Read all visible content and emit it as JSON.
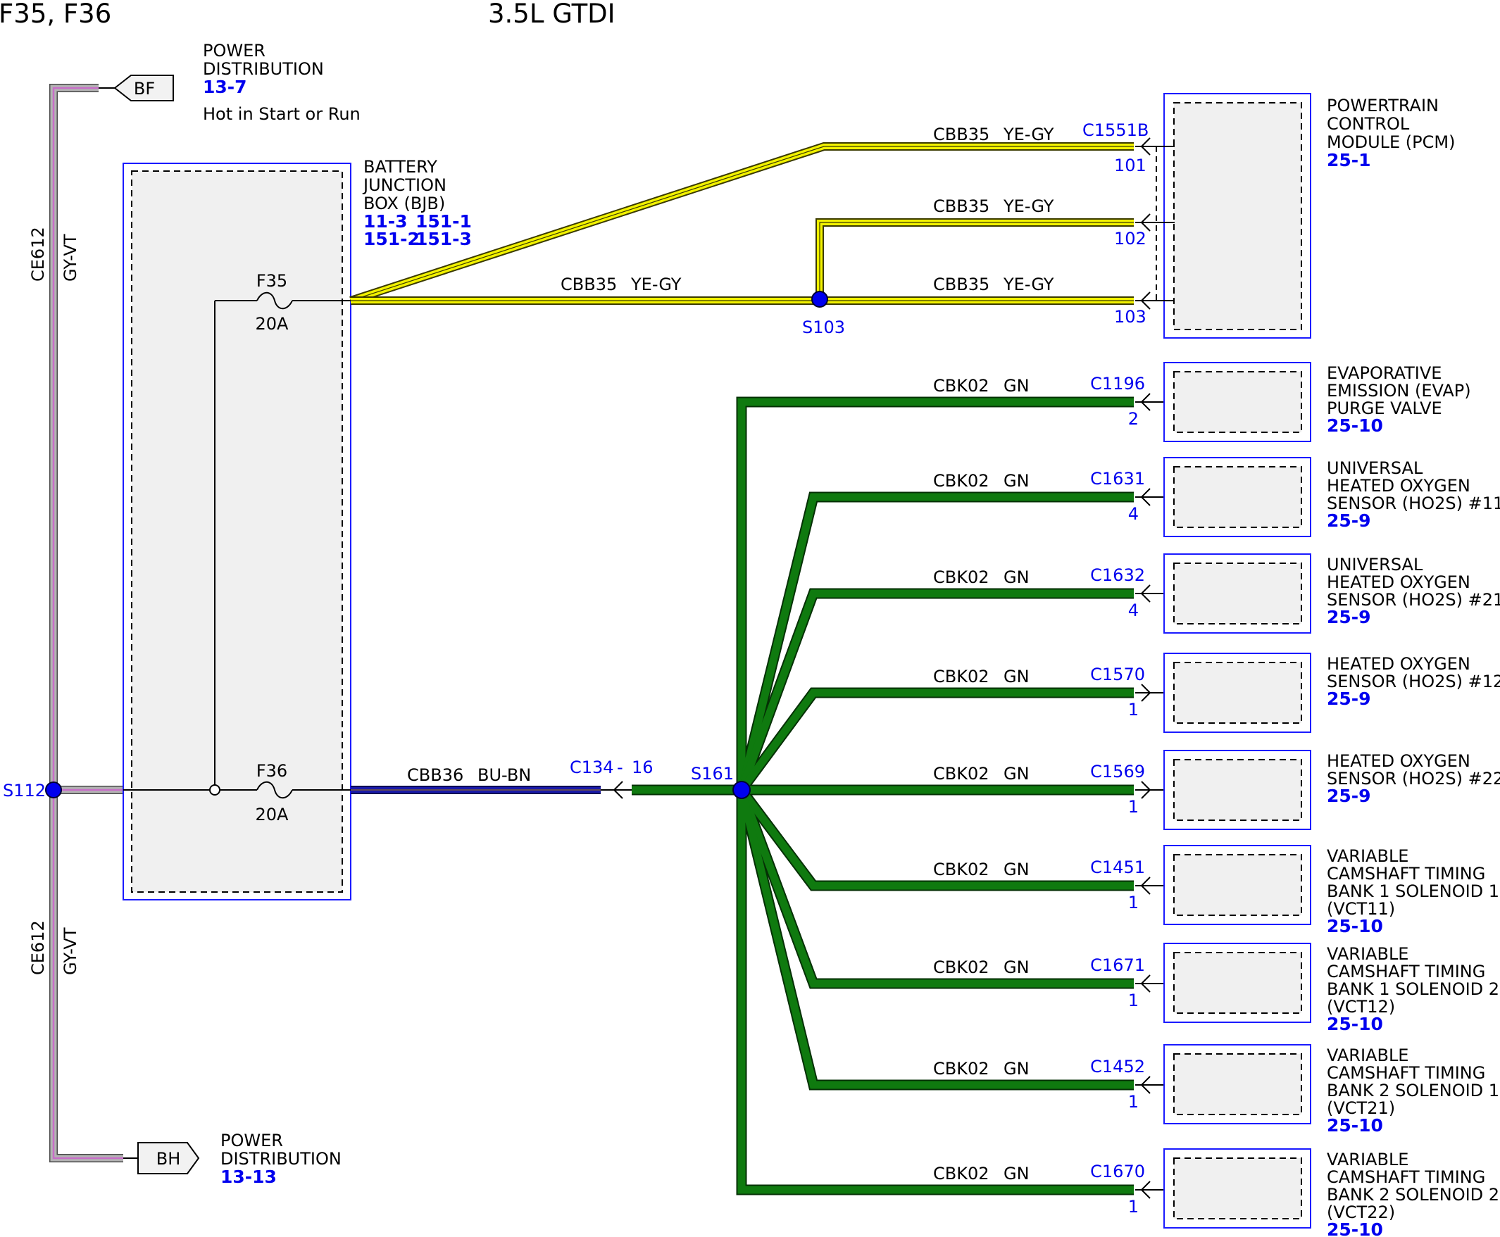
{
  "page": {
    "title_left": "F35, F36",
    "title_center": "3.5L GTDI"
  },
  "power_in": {
    "tag": "BF",
    "line1": "POWER",
    "line2": "DISTRIBUTION",
    "ref": "13-7",
    "note": "Hot in Start or Run"
  },
  "power_out": {
    "tag": "BH",
    "line1": "POWER",
    "line2": "DISTRIBUTION",
    "ref": "13-13"
  },
  "left_wire": {
    "circuit": "CE612",
    "color": "GY-VT",
    "splice": "S112"
  },
  "bjb": {
    "line1": "BATTERY",
    "line2": "JUNCTION",
    "line3": "BOX (BJB)",
    "ref1": "11-3",
    "ref2": "151-1",
    "ref3": "151-2",
    "ref4": "151-3",
    "fuse1_name": "F35",
    "fuse1_rating": "20A",
    "fuse2_name": "F36",
    "fuse2_rating": "20A"
  },
  "yellow": {
    "circuit": "CBB35",
    "color": "YE-GY",
    "splice": "S103",
    "connector": "C1551B",
    "pin1": "101",
    "pin2": "102",
    "pin3": "103"
  },
  "blue_wire": {
    "circuit": "CBB36",
    "color": "BU-BN",
    "connector": "C134",
    "dash": "-",
    "pin": "16"
  },
  "green": {
    "splice": "S161",
    "circuit": "CBK02",
    "color": "GN"
  },
  "pcm": {
    "line1": "POWERTRAIN",
    "line2": "CONTROL",
    "line3": "MODULE (PCM)",
    "ref": "25-1"
  },
  "components": [
    {
      "connector": "C1196",
      "pin": "2",
      "lines": [
        "EVAPORATIVE",
        "EMISSION (EVAP)",
        "PURGE VALVE"
      ],
      "ref": "25-10"
    },
    {
      "connector": "C1631",
      "pin": "4",
      "lines": [
        "UNIVERSAL",
        "HEATED OXYGEN",
        "SENSOR (HO2S) #11"
      ],
      "ref": "25-9"
    },
    {
      "connector": "C1632",
      "pin": "4",
      "lines": [
        "UNIVERSAL",
        "HEATED OXYGEN",
        "SENSOR (HO2S) #21"
      ],
      "ref": "25-9"
    },
    {
      "connector": "C1570",
      "pin": "1",
      "lines": [
        "HEATED OXYGEN",
        "SENSOR (HO2S) #12"
      ],
      "ref": "25-9"
    },
    {
      "connector": "C1569",
      "pin": "1",
      "lines": [
        "HEATED OXYGEN",
        "SENSOR (HO2S) #22"
      ],
      "ref": "25-9"
    },
    {
      "connector": "C1451",
      "pin": "1",
      "lines": [
        "VARIABLE",
        "CAMSHAFT TIMING",
        "BANK 1 SOLENOID 1",
        "(VCT11)"
      ],
      "ref": "25-10"
    },
    {
      "connector": "C1671",
      "pin": "1",
      "lines": [
        "VARIABLE",
        "CAMSHAFT TIMING",
        "BANK 1 SOLENOID 2",
        "(VCT12)"
      ],
      "ref": "25-10"
    },
    {
      "connector": "C1452",
      "pin": "1",
      "lines": [
        "VARIABLE",
        "CAMSHAFT TIMING",
        "BANK 2 SOLENOID 1",
        "(VCT21)"
      ],
      "ref": "25-10"
    },
    {
      "connector": "C1670",
      "pin": "1",
      "lines": [
        "VARIABLE",
        "CAMSHAFT TIMING",
        "BANK 2 SOLENOID 2",
        "(VCT22)"
      ],
      "ref": "25-10"
    }
  ],
  "colors": {
    "yellow_wire": "#f2f200",
    "green_wire": "#0f7a0f",
    "blue_wire": "#1a1aa8",
    "gray_violet_wire": "#8c8c8c",
    "box_border": "#1a1aff",
    "box_fill": "#f0f0f0",
    "ref_blue": "#0000ee"
  }
}
